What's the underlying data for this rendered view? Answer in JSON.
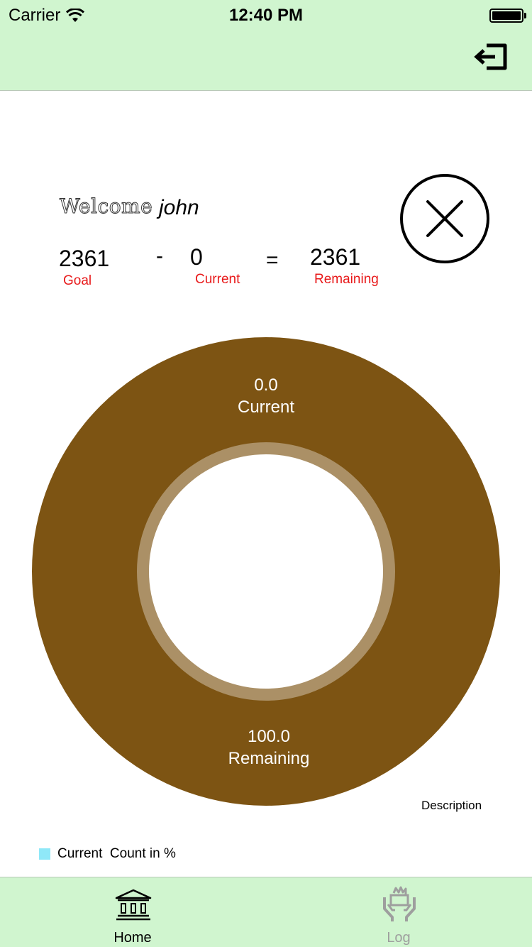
{
  "status_bar": {
    "carrier": "Carrier",
    "time": "12:40 PM"
  },
  "header": {
    "logout_icon": "logout-icon"
  },
  "welcome": {
    "greeting": "Welcome",
    "username": "john"
  },
  "equation": {
    "goal_value": "2361",
    "goal_label": "Goal",
    "minus": "-",
    "current_value": "0",
    "current_label": "Current",
    "equals": "=",
    "remaining_value": "2361",
    "remaining_label": "Remaining"
  },
  "close_icon": "close-circle-icon",
  "chart_data": {
    "type": "pie",
    "variant": "donut",
    "slices": [
      {
        "label": "Current",
        "value": 0.0,
        "value_text": "0.0"
      },
      {
        "label": "Remaining",
        "value": 100.0,
        "value_text": "100.0"
      }
    ],
    "colors": {
      "ring": "#7d5413",
      "inner_ring": "#ab9066",
      "center": "#ffffff"
    },
    "description": "Description",
    "legend": {
      "label": "Current  Count in %",
      "color": "#8fe8f8",
      "placement": "bottom-left"
    }
  },
  "tabs": [
    {
      "label": "Home",
      "icon": "bank-icon",
      "active": true
    },
    {
      "label": "Log",
      "icon": "hands-basket-icon",
      "active": false
    }
  ],
  "colors": {
    "bar_background": "#d0f5cf",
    "label_red": "#e8191a",
    "inactive_tab": "#9e9e9e"
  }
}
